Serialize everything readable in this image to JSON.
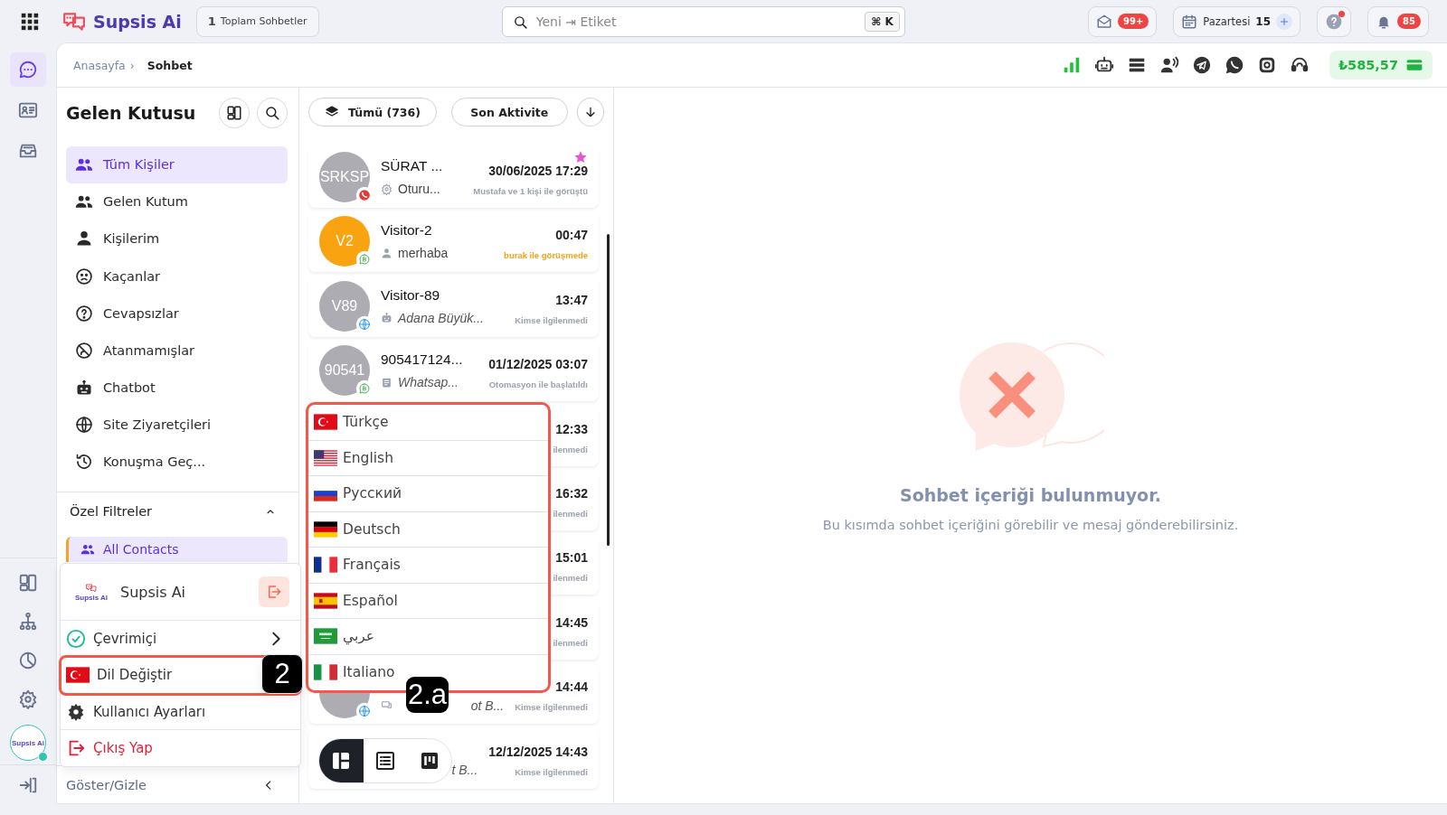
{
  "topbar": {
    "brand": "Supsis Ai",
    "conversation_count": {
      "count": "1",
      "label": "Toplam Sohbetler"
    },
    "search": {
      "placeholder": "Yeni ⇥ Etiket",
      "shortcut": "⌘ K"
    },
    "mail_badge": "99+",
    "date": {
      "day_name": "Pazartesi",
      "day_number": "15"
    },
    "notification_badge": "85"
  },
  "rail": {
    "top": [
      {
        "kind": "chat",
        "selected": true
      },
      {
        "kind": "card",
        "selected": false
      },
      {
        "kind": "tray",
        "selected": false
      }
    ],
    "bottom": [
      {
        "kind": "layout",
        "selected": false
      },
      {
        "kind": "hierarchy",
        "selected": false
      },
      {
        "kind": "pie",
        "selected": false
      },
      {
        "kind": "gear",
        "selected": false
      }
    ],
    "avatar_caption": "Supsis Ai",
    "online": true
  },
  "breadcrumb": [
    {
      "label": "Anasayfa",
      "current": false
    },
    {
      "label": "Sohbet",
      "current": true
    }
  ],
  "breadcrumb_separator": "›",
  "balance": "₺585,57",
  "inbox": {
    "title": "Gelen Kutusu",
    "items": [
      {
        "label": "Tüm Kişiler",
        "kind": "people",
        "selected": true
      },
      {
        "label": "Gelen Kutum",
        "kind": "people",
        "selected": false
      },
      {
        "label": "Kişilerim",
        "kind": "person",
        "selected": false
      },
      {
        "label": "Kaçanlar",
        "kind": "sad",
        "selected": false
      },
      {
        "label": "Cevapsızlar",
        "kind": "question",
        "selected": false
      },
      {
        "label": "Atanmamışlar",
        "kind": "blocked",
        "selected": false
      },
      {
        "label": "Chatbot",
        "kind": "robot",
        "selected": false
      },
      {
        "label": "Site Ziyaretçileri",
        "kind": "globe",
        "selected": false
      },
      {
        "label": "Konuşma Geç...",
        "kind": "history",
        "selected": false
      }
    ],
    "filters": {
      "title": "Özel Filtreler",
      "expanded": true,
      "items": [
        {
          "label": "All Contacts",
          "selected": true
        }
      ]
    },
    "footer": "Göster/Gizle"
  },
  "filter_bar": {
    "all": "Tümü (736)",
    "sort": "Son Aktivite"
  },
  "conversations": [
    {
      "avatar": {
        "initials": "SRKSP",
        "color": "#acacb2"
      },
      "channel": {
        "kind": "phone"
      },
      "name": "SÜRAT ...",
      "preview_icon": {
        "kind": "gear"
      },
      "preview": "Oturu...",
      "automated": false,
      "time": "30/06/2025 17:29",
      "status": "Mustafa ve 1 kişi ile görüştü",
      "status_active": false,
      "starred": true
    },
    {
      "avatar": {
        "initials": "V2",
        "color": "#f8a30f"
      },
      "channel": {
        "kind": "whatsapp"
      },
      "name": "Visitor-2",
      "preview_icon": {
        "kind": "person"
      },
      "preview": "merhaba",
      "automated": false,
      "time": "00:47",
      "status": "burak ile görüşmede",
      "status_active": true,
      "starred": false
    },
    {
      "avatar": {
        "initials": "V89",
        "color": "#acacb2"
      },
      "channel": {
        "kind": "web"
      },
      "name": "Visitor-89",
      "preview_icon": {
        "kind": "robot"
      },
      "preview": "Adana Büyük...",
      "automated": true,
      "time": "13:47",
      "status": "Kimse ilgilenmedi",
      "status_active": false,
      "starred": false
    },
    {
      "avatar": {
        "initials": "90541",
        "color": "#acacb2"
      },
      "channel": {
        "kind": "whatsapp"
      },
      "name": "905417124...",
      "preview_icon": {
        "kind": "doc"
      },
      "preview": "Whatsap...",
      "automated": true,
      "time": "01/12/2025 03:07",
      "status": "Otomasyon ile başlatıldı",
      "status_active": false,
      "starred": false
    },
    {
      "time": "12:33",
      "status": "ilenmedi",
      "status_active": false,
      "starred": false
    },
    {
      "time": "16:32",
      "status": "ilenmedi",
      "status_active": false,
      "starred": false
    },
    {
      "time": "15:01",
      "status": "ilenmedi",
      "status_active": false,
      "starred": false
    },
    {
      "time": "14:45",
      "status": "ilenmedi",
      "status_active": false,
      "starred": false
    },
    {
      "avatar": {
        "color": "#acacb2"
      },
      "channel": {
        "kind": "web"
      },
      "preview_icon": {
        "kind": "device"
      },
      "preview": "ot B...",
      "automated": true,
      "time": "14:44",
      "status": "Kimse ilgilenmedi",
      "status_active": false,
      "starred": false
    },
    {
      "preview": "t B...",
      "automated": true,
      "time": "12/12/2025 14:43",
      "status": "Kimse ilgilenmedi",
      "status_active": false,
      "starred": false
    }
  ],
  "empty_state": {
    "title": "Sohbet içeriği bulunmuyor.",
    "text": "Bu kısımda sohbet içeriğini görebilir ve mesaj gönderebilirsiniz."
  },
  "user_menu": {
    "logo_caption": "Supsis AI",
    "name": "Supsis Ai",
    "status": "Çevrimiçi",
    "items": [
      {
        "kind": "language",
        "label": "Dil Değiştir",
        "highlighted": true
      },
      {
        "kind": "settings",
        "label": "Kullanıcı Ayarları",
        "highlighted": false
      },
      {
        "kind": "logout",
        "label": "Çıkış Yap",
        "highlighted": false
      }
    ]
  },
  "language_menu": {
    "highlighted": true,
    "items": [
      {
        "flag": {
          "kind": "tr"
        },
        "label": "Türkçe"
      },
      {
        "flag": {
          "kind": "us"
        },
        "label": "English"
      },
      {
        "flag": {
          "kind": "ru"
        },
        "label": "Русский"
      },
      {
        "flag": {
          "kind": "de"
        },
        "label": "Deutsch"
      },
      {
        "flag": {
          "kind": "fr"
        },
        "label": "Français"
      },
      {
        "flag": {
          "kind": "es"
        },
        "label": "Español"
      },
      {
        "flag": {
          "kind": "sa"
        },
        "label": "عربي"
      },
      {
        "flag": {
          "kind": "it"
        },
        "label": "Italiano"
      }
    ]
  },
  "callouts": [
    {
      "kind": "user-menu",
      "label": "2"
    },
    {
      "kind": "language-menu",
      "label": "2.a"
    }
  ],
  "view_toggle": [
    {
      "kind": "cards",
      "selected": true
    },
    {
      "kind": "list",
      "selected": false
    },
    {
      "kind": "board",
      "selected": false
    }
  ]
}
